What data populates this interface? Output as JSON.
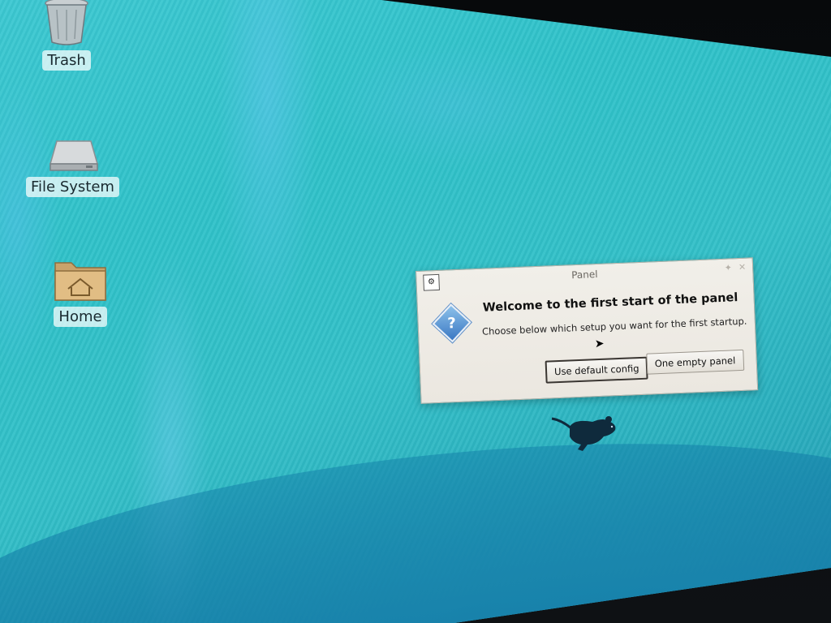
{
  "desktop": {
    "icons": [
      {
        "label": "Trash",
        "icon": "trash-icon"
      },
      {
        "label": "File System",
        "icon": "drive-icon"
      },
      {
        "label": "Home",
        "icon": "home-folder-icon"
      }
    ],
    "logo": "xfce-mouse-icon"
  },
  "dialog": {
    "title": "Panel",
    "heading": "Welcome to the first start of the panel",
    "message": "Choose below which setup you want for the first startup.",
    "buttons": {
      "default_label": "Use default config",
      "empty_label": "One empty panel"
    },
    "icon": "question-icon"
  },
  "colors": {
    "desktop_teal": "#33c0c8",
    "dialog_bg": "#efece6",
    "question_blue": "#3b78c3"
  }
}
